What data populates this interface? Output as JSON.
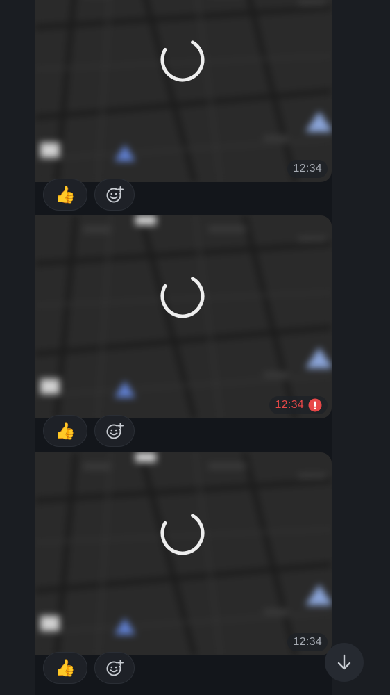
{
  "messages": [
    {
      "time": "12:34",
      "status": "sent",
      "reactions": {
        "emoji": "👍"
      }
    },
    {
      "time": "12:34",
      "status": "failed",
      "reactions": {
        "emoji": "👍"
      }
    },
    {
      "time": "12:34",
      "status": "sent",
      "reactions": {
        "emoji": "👍"
      }
    }
  ],
  "icons": {
    "loading": "loading-spinner-icon",
    "error": "error-icon",
    "add_reaction": "add-reaction-icon",
    "scroll_down": "arrow-down-icon"
  },
  "colors": {
    "background": "#1a1d22",
    "failed_time": "#e84848"
  }
}
